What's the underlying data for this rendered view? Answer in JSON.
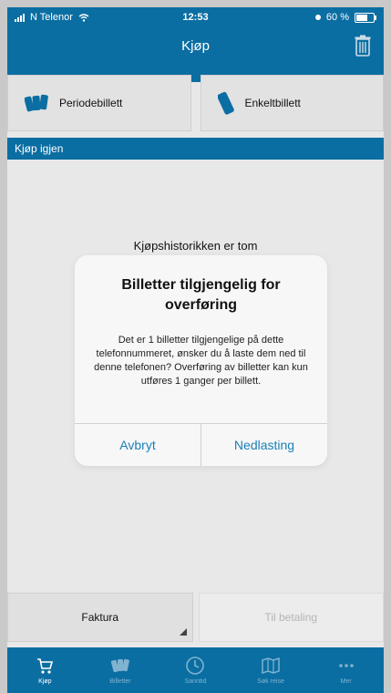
{
  "status_bar": {
    "carrier": "N Telenor",
    "time": "12:53",
    "battery": "60 %"
  },
  "header": {
    "title": "Kjøp"
  },
  "ticket_types": [
    {
      "label": "Periodebillett"
    },
    {
      "label": "Enkeltbillett"
    }
  ],
  "section": {
    "title": "Kjøp igjen"
  },
  "empty_state": {
    "text": "Kjøpshistorikken er tom"
  },
  "dialog": {
    "title": "Billetter tilgjengelig for overføring",
    "body": "Det er 1 billetter tilgjengelige på dette telefonnummeret, ønsker du å laste dem ned til denne telefonen? Overføring av billetter kan kun utføres 1 ganger per billett.",
    "cancel_label": "Avbryt",
    "confirm_label": "Nedlasting"
  },
  "bottom_actions": {
    "invoice_label": "Faktura",
    "pay_label": "Til betaling"
  },
  "tabbar": {
    "items": [
      {
        "label": "Kjøp",
        "icon": "cart-icon",
        "active": true
      },
      {
        "label": "Billetter",
        "icon": "tickets-icon",
        "active": false
      },
      {
        "label": "Sanntid",
        "icon": "clock-icon",
        "active": false
      },
      {
        "label": "Søk reise",
        "icon": "map-icon",
        "active": false
      },
      {
        "label": "Mer",
        "icon": "more-icon",
        "active": false
      }
    ]
  },
  "colors": {
    "brand_blue": "#0b6ea2",
    "dialog_button": "#1a7fb8"
  }
}
